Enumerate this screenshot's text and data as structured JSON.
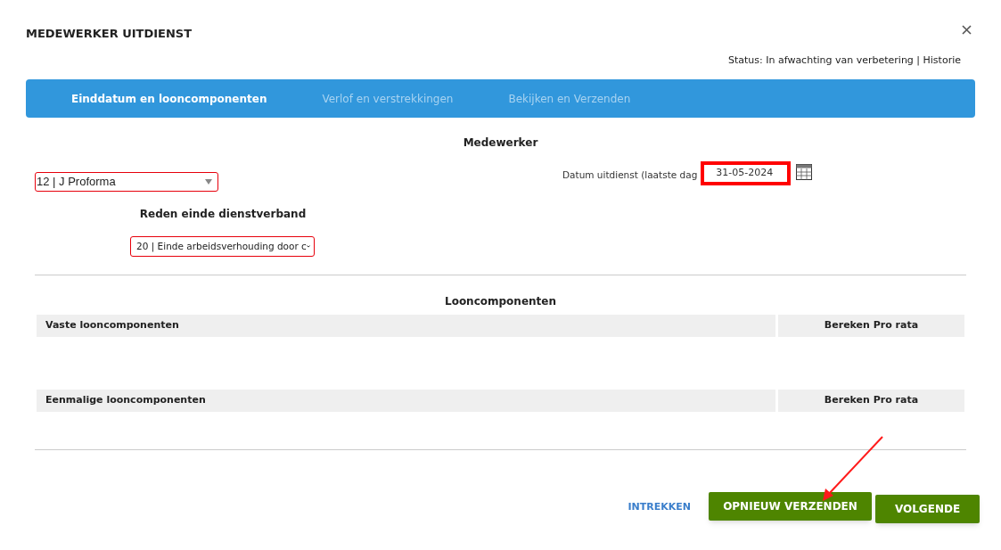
{
  "dialog": {
    "title": "MEDEWERKER UITDIENST",
    "status": "Status: In afwachting van verbetering | Historie"
  },
  "tabs": [
    {
      "label": "Einddatum en looncomponenten",
      "selected": true
    },
    {
      "label": "Verlof en verstrekkingen",
      "selected": false
    },
    {
      "label": "Bekijken en Verzenden",
      "selected": false
    }
  ],
  "employee": {
    "heading": "Medewerker",
    "value": "12 | J Proforma",
    "date_label": "Datum uitdienst (laatste dag",
    "date_value": "31-05-2024"
  },
  "reason": {
    "heading": "Reden einde dienstverband",
    "value": "20 | Einde arbeidsverhouding door c"
  },
  "wage_components": {
    "heading": "Looncomponenten",
    "tables": [
      {
        "column_1": "Vaste looncomponenten",
        "column_2": "Bereken Pro rata"
      },
      {
        "column_1": "Eenmalige looncomponenten",
        "column_2": "Bereken Pro rata"
      }
    ]
  },
  "buttons": {
    "withdraw": "INTREKKEN",
    "resend": "OPNIEUW VERZENDEN",
    "next": "VOLGENDE"
  }
}
